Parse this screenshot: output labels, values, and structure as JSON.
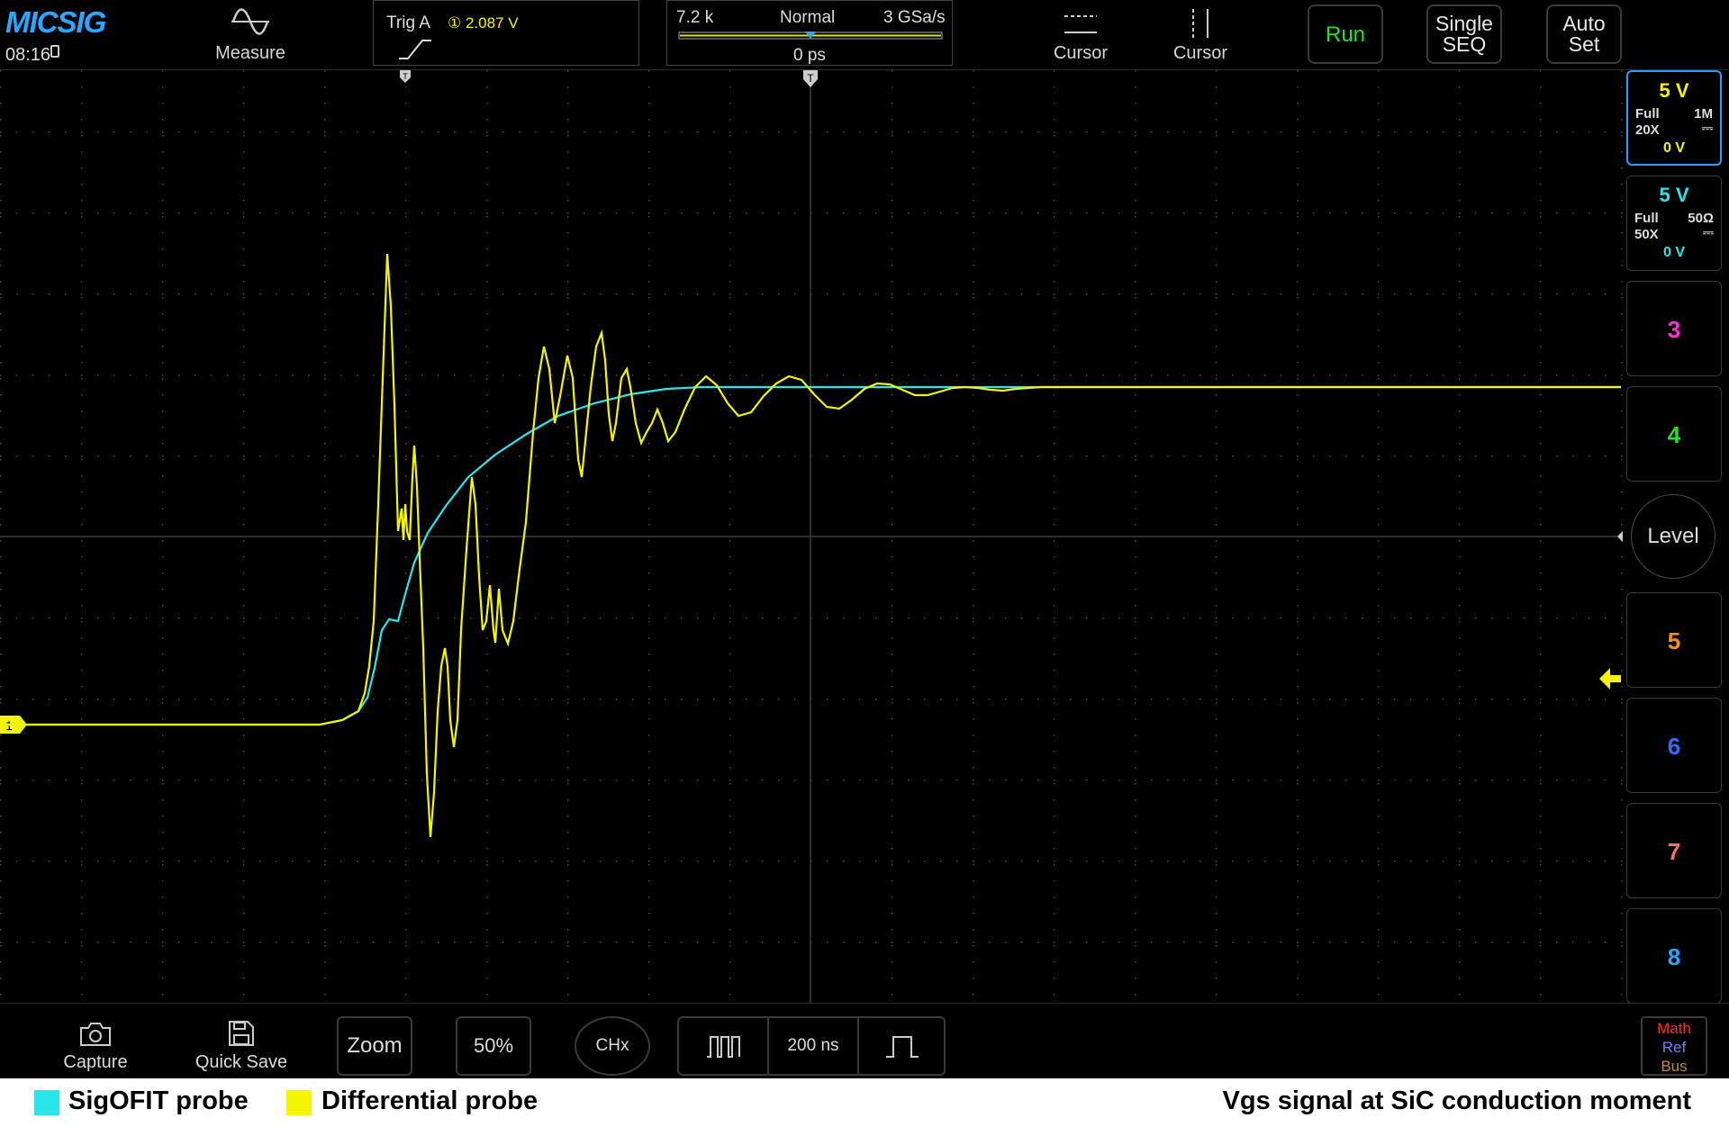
{
  "topbar": {
    "logo": "MICSIG",
    "clock": "08:16",
    "measure_label": "Measure",
    "trigger": {
      "label": "Trig A",
      "source_level": "① 2.087 V"
    },
    "horizontal": {
      "memory_depth": "7.2 k",
      "mode": "Normal",
      "sample_rate": "3 GSa/s",
      "position": "0 ps"
    },
    "cursor_h_label": "Cursor",
    "cursor_v_label": "Cursor",
    "run_label": "Run",
    "single_label_line1": "Single",
    "single_label_line2": "SEQ",
    "autoset_label_line1": "Auto",
    "autoset_label_line2": "Set"
  },
  "channels": [
    {
      "scale": "5 V",
      "bandwidth": "Full",
      "impedance": "1M",
      "probe": "20X",
      "coupling": "⎓",
      "offset": "0 V",
      "color": "#f5f500"
    },
    {
      "scale": "5 V",
      "bandwidth": "Full",
      "impedance": "50Ω",
      "probe": "50X",
      "coupling": "⎓",
      "offset": "0 V",
      "color": "#29e6ec"
    },
    {
      "number": "3",
      "color": "#ff2fd6"
    },
    {
      "number": "4",
      "color": "#24e024"
    },
    {
      "number": "5",
      "color": "#ff8c1a"
    },
    {
      "number": "6",
      "color": "#2f6bff"
    },
    {
      "number": "7",
      "color": "#ff6f6f"
    },
    {
      "number": "8",
      "color": "#22a6ff"
    }
  ],
  "level_label": "Level",
  "ch1_marker": "1",
  "bottombar": {
    "capture_label": "Capture",
    "quicksave_label": "Quick Save",
    "zoom_label": "Zoom",
    "percent_label": "50%",
    "chx_label": "CHx",
    "timebase_label": "200 ns",
    "math_label": "Math",
    "ref_label": "Ref",
    "bus_label": "Bus"
  },
  "caption": {
    "legend_1": "SigOFIT probe",
    "legend_2": "Differential probe",
    "title": "Vgs signal at SiC conduction moment",
    "legend_1_color": "#29e6ec",
    "legend_2_color": "#f5f500"
  },
  "colors": {
    "accent": "#2aa7ff",
    "run": "#22e022",
    "ch1": "#f5f500",
    "ch2": "#29e6ec",
    "math": "#ff2a2a",
    "ref": "#7a7aff",
    "bus": "#c48a3a"
  }
}
